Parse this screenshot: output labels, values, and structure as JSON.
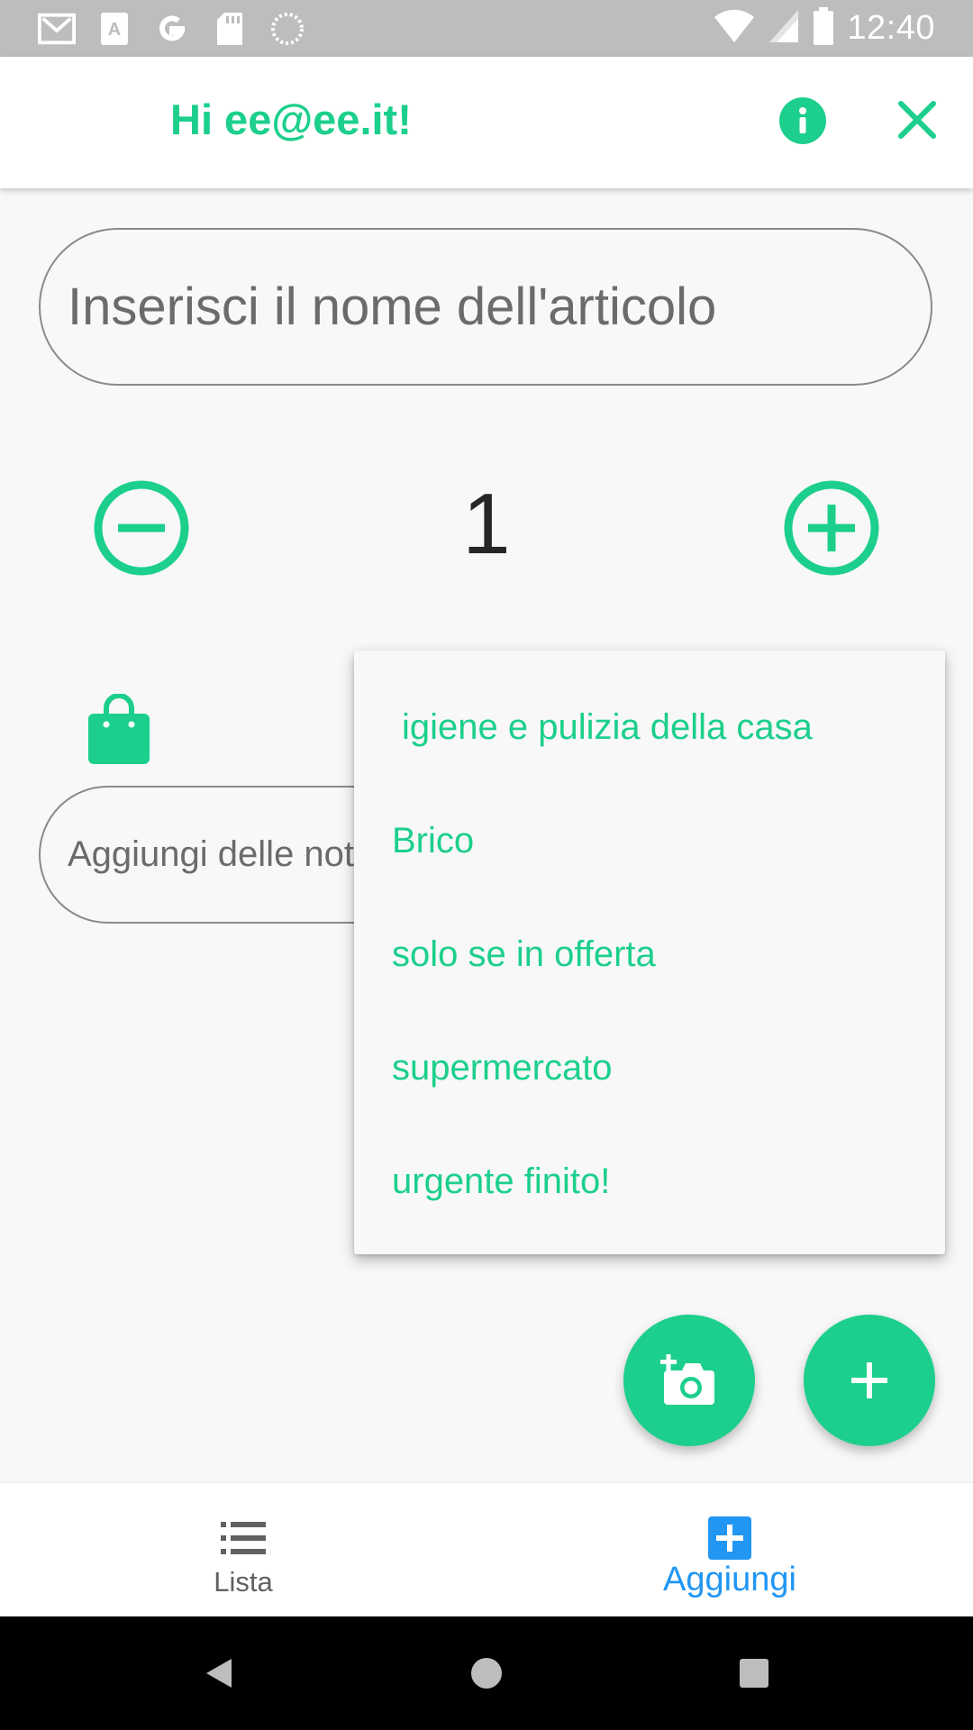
{
  "status_bar": {
    "time": "12:40",
    "left_icons": [
      "gmail-icon",
      "font-app-icon",
      "google-icon",
      "sd-card-icon",
      "sync-icon"
    ],
    "right_icons": [
      "wifi-icon",
      "cell-signal-icon",
      "battery-icon"
    ]
  },
  "app_bar": {
    "greeting": "Hi ee@ee.it!",
    "info_icon": "info-icon",
    "close_icon": "close-icon"
  },
  "item_form": {
    "name_placeholder": "Inserisci il nome dell'articolo",
    "quantity": "1",
    "notes_placeholder": "Aggiungi delle note"
  },
  "category_menu": {
    "items": [
      " igiene e pulizia della casa",
      "Brico",
      "solo se in offerta",
      "supermercato",
      "urgente finito!"
    ]
  },
  "fabs": {
    "camera_icon": "add-photo-icon",
    "add_icon": "plus-icon"
  },
  "bottom_nav": {
    "items": [
      {
        "label": "Lista",
        "icon": "list-icon",
        "active": false
      },
      {
        "label": "Aggiungi",
        "icon": "add-box-icon",
        "active": true
      }
    ]
  },
  "colors": {
    "accent": "#1ccf8c",
    "active_nav": "#2196f3",
    "status_bar": "#bdbdbd"
  }
}
